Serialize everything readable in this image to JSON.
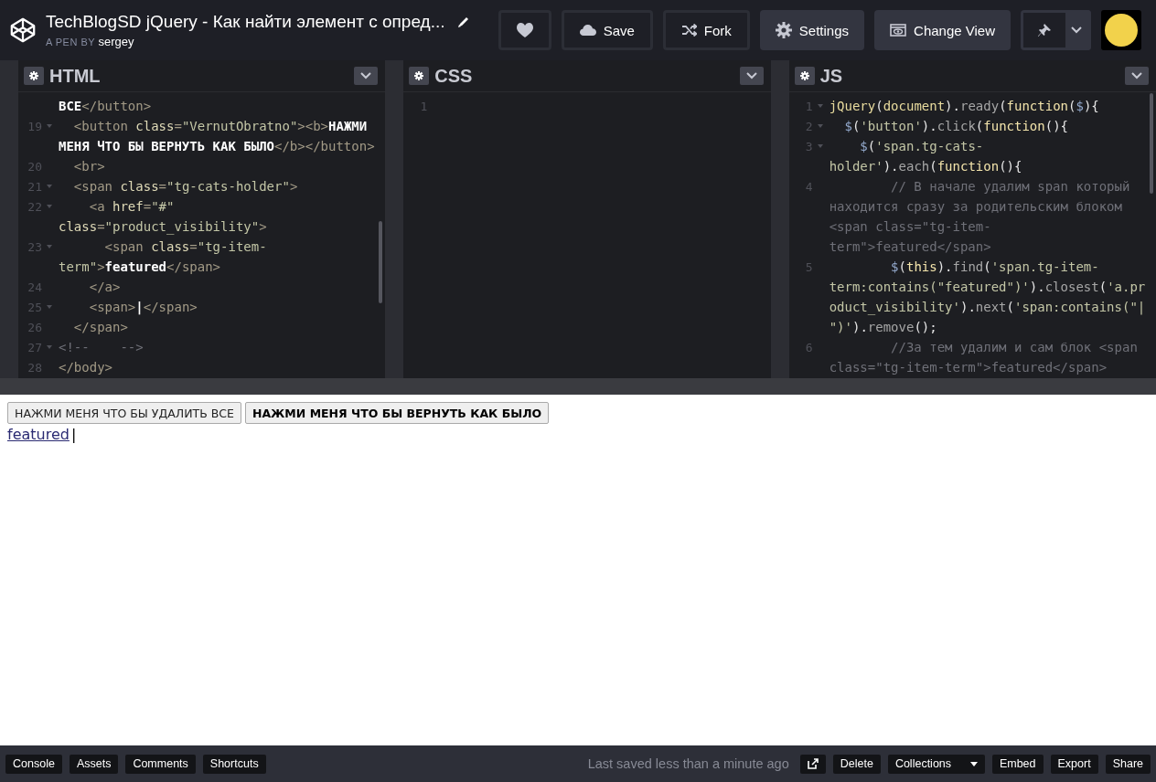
{
  "header": {
    "title": "TechBlogSD jQuery - Как найти элемент с опред...",
    "byline": "A PEN BY",
    "author": "sergey",
    "buttons": [
      {
        "kind": "heart"
      },
      {
        "kind": "save",
        "label": "Save"
      },
      {
        "kind": "fork",
        "label": "Fork"
      },
      {
        "kind": "settings",
        "label": "Settings"
      },
      {
        "kind": "view",
        "label": "Change View"
      },
      {
        "kind": "pin"
      }
    ]
  },
  "editors": [
    {
      "title": "HTML",
      "lines": [
        {
          "segments": [
            {
              "kind": "text",
              "text": "ВСЕ"
            },
            {
              "kind": "tag",
              "text": "</button>"
            }
          ]
        },
        {
          "number": "19",
          "fold": true,
          "segments": [
            {
              "kind": "tag",
              "text": "  <button "
            },
            {
              "kind": "attr",
              "text": "class"
            },
            {
              "kind": "tag",
              "text": "="
            },
            {
              "kind": "string",
              "text": "\"VernutObratno\""
            },
            {
              "kind": "tag",
              "text": "><b>"
            },
            {
              "kind": "text",
              "text": "НАЖМИ"
            }
          ]
        },
        {
          "segments": [
            {
              "kind": "text",
              "text": "МЕНЯ ЧТО БЫ ВЕРНУТЬ КАК БЫЛО"
            },
            {
              "kind": "tag",
              "text": "</b></button>"
            }
          ]
        },
        {
          "number": "20",
          "fold": false,
          "segments": [
            {
              "kind": "tag",
              "text": "  <br>"
            }
          ]
        },
        {
          "number": "21",
          "fold": true,
          "segments": [
            {
              "kind": "tag",
              "text": "  <span "
            },
            {
              "kind": "attr",
              "text": "class"
            },
            {
              "kind": "tag",
              "text": "="
            },
            {
              "kind": "string",
              "text": "\"tg-cats-holder\""
            },
            {
              "kind": "tag",
              "text": ">"
            }
          ]
        },
        {
          "number": "22",
          "fold": true,
          "segments": [
            {
              "kind": "tag",
              "text": "    <a "
            },
            {
              "kind": "attr",
              "text": "href"
            },
            {
              "kind": "tag",
              "text": "="
            },
            {
              "kind": "string",
              "text": "\"#\""
            }
          ]
        },
        {
          "segments": [
            {
              "kind": "attr",
              "text": "class"
            },
            {
              "kind": "tag",
              "text": "="
            },
            {
              "kind": "string",
              "text": "\"product_visibility\""
            },
            {
              "kind": "tag",
              "text": ">"
            }
          ]
        },
        {
          "number": "23",
          "fold": true,
          "segments": [
            {
              "kind": "tag",
              "text": "      <span "
            },
            {
              "kind": "attr",
              "text": "class"
            },
            {
              "kind": "tag",
              "text": "="
            },
            {
              "kind": "string",
              "text": "\"tg-item-"
            }
          ]
        },
        {
          "segments": [
            {
              "kind": "string",
              "text": "term\""
            },
            {
              "kind": "tag",
              "text": ">"
            },
            {
              "kind": "text",
              "text": "featured"
            },
            {
              "kind": "tag",
              "text": "</span>"
            }
          ]
        },
        {
          "number": "24",
          "fold": false,
          "segments": [
            {
              "kind": "tag",
              "text": "    </a>"
            }
          ]
        },
        {
          "number": "25",
          "fold": true,
          "segments": [
            {
              "kind": "tag",
              "text": "    <span>"
            },
            {
              "kind": "text",
              "text": "|"
            },
            {
              "kind": "tag",
              "text": "</span>"
            }
          ]
        },
        {
          "number": "26",
          "fold": false,
          "segments": [
            {
              "kind": "tag",
              "text": "  </span>"
            }
          ]
        },
        {
          "number": "27",
          "fold": true,
          "segments": [
            {
              "kind": "comment",
              "text": "<!--    -->"
            }
          ]
        },
        {
          "number": "28",
          "fold": false,
          "segments": [
            {
              "kind": "tag",
              "text": "</body>"
            }
          ]
        }
      ]
    },
    {
      "title": "CSS",
      "lines": [
        {
          "number": "1",
          "fold": false
        }
      ]
    },
    {
      "title": "JS",
      "lines": [
        {
          "number": "1",
          "fold": true,
          "segments": [
            {
              "kind": "ident",
              "text": "jQuery"
            },
            {
              "kind": "punc",
              "text": "("
            },
            {
              "kind": "ident",
              "text": "document"
            },
            {
              "kind": "punc",
              "text": ")."
            },
            {
              "kind": "method",
              "text": "ready"
            },
            {
              "kind": "punc",
              "text": "("
            },
            {
              "kind": "keyword",
              "text": "function"
            },
            {
              "kind": "punc",
              "text": "("
            },
            {
              "kind": "var",
              "text": "$"
            },
            {
              "kind": "punc",
              "text": "){"
            }
          ]
        },
        {
          "number": "2",
          "fold": true,
          "segments": [
            {
              "kind": "var",
              "text": "  $"
            },
            {
              "kind": "punc",
              "text": "("
            },
            {
              "kind": "string",
              "text": "'button'"
            },
            {
              "kind": "punc",
              "text": ")."
            },
            {
              "kind": "method",
              "text": "click"
            },
            {
              "kind": "punc",
              "text": "("
            },
            {
              "kind": "keyword",
              "text": "function"
            },
            {
              "kind": "punc",
              "text": "(){"
            }
          ]
        },
        {
          "number": "3",
          "fold": true,
          "segments": [
            {
              "kind": "var",
              "text": "    $"
            },
            {
              "kind": "punc",
              "text": "("
            },
            {
              "kind": "string",
              "text": "'span.tg-cats-"
            }
          ]
        },
        {
          "segments": [
            {
              "kind": "string",
              "text": "holder'"
            },
            {
              "kind": "punc",
              "text": ")."
            },
            {
              "kind": "method",
              "text": "each"
            },
            {
              "kind": "punc",
              "text": "("
            },
            {
              "kind": "keyword",
              "text": "function"
            },
            {
              "kind": "punc",
              "text": "(){"
            }
          ]
        },
        {
          "number": "4",
          "fold": false,
          "segments": [
            {
              "kind": "comment",
              "text": "        // В начале удалим span который"
            }
          ]
        },
        {
          "segments": [
            {
              "kind": "comment",
              "text": "находится сразу за родительским блоком"
            }
          ]
        },
        {
          "segments": [
            {
              "kind": "comment",
              "text": "<span class=\"tg-item-"
            }
          ]
        },
        {
          "segments": [
            {
              "kind": "comment",
              "text": "term\">featured</span>"
            }
          ]
        },
        {
          "number": "5",
          "fold": false,
          "segments": [
            {
              "kind": "var",
              "text": "        $"
            },
            {
              "kind": "punc",
              "text": "("
            },
            {
              "kind": "keyword",
              "text": "this"
            },
            {
              "kind": "punc",
              "text": ")."
            },
            {
              "kind": "method",
              "text": "find"
            },
            {
              "kind": "punc",
              "text": "("
            },
            {
              "kind": "string",
              "text": "'span.tg-item-"
            }
          ]
        },
        {
          "segments": [
            {
              "kind": "string",
              "text": "term:contains(\"featured\")'"
            },
            {
              "kind": "punc",
              "text": ")."
            },
            {
              "kind": "method",
              "text": "closest"
            },
            {
              "kind": "punc",
              "text": "("
            },
            {
              "kind": "string",
              "text": "'a.pr"
            }
          ]
        },
        {
          "segments": [
            {
              "kind": "string",
              "text": "oduct_visibility'"
            },
            {
              "kind": "punc",
              "text": ")."
            },
            {
              "kind": "method",
              "text": "next"
            },
            {
              "kind": "punc",
              "text": "("
            },
            {
              "kind": "string",
              "text": "'span:contains(\"|"
            }
          ]
        },
        {
          "segments": [
            {
              "kind": "string",
              "text": "\")'"
            },
            {
              "kind": "punc",
              "text": ")."
            },
            {
              "kind": "method",
              "text": "remove"
            },
            {
              "kind": "punc",
              "text": "();"
            }
          ]
        },
        {
          "number": "6",
          "fold": false,
          "segments": [
            {
              "kind": "comment",
              "text": "        //За тем удалим и сам блок <span"
            }
          ]
        },
        {
          "segments": [
            {
              "kind": "comment",
              "text": "class=\"tg-item-term\">featured</span>"
            }
          ]
        }
      ]
    }
  ],
  "result": {
    "buttons": [
      {
        "label": "НАЖМИ МЕНЯ ЧТО БЫ УДАЛИТЬ ВСЕ",
        "bold": false
      },
      {
        "label": "НАЖМИ МЕНЯ ЧТО БЫ ВЕРНУТЬ КАК БЫЛО",
        "bold": true
      }
    ],
    "link": "featured",
    "after_link": "|"
  },
  "footer": {
    "left": [
      "Console",
      "Assets",
      "Comments",
      "Shortcuts"
    ],
    "status": "Last saved less than a minute ago",
    "right": [
      {
        "kind": "external"
      },
      {
        "kind": "button",
        "label": "Delete"
      },
      {
        "kind": "dropdown",
        "label": "Collections"
      },
      {
        "kind": "button",
        "label": "Embed"
      },
      {
        "kind": "button",
        "label": "Export"
      },
      {
        "kind": "button",
        "label": "Share"
      }
    ]
  }
}
